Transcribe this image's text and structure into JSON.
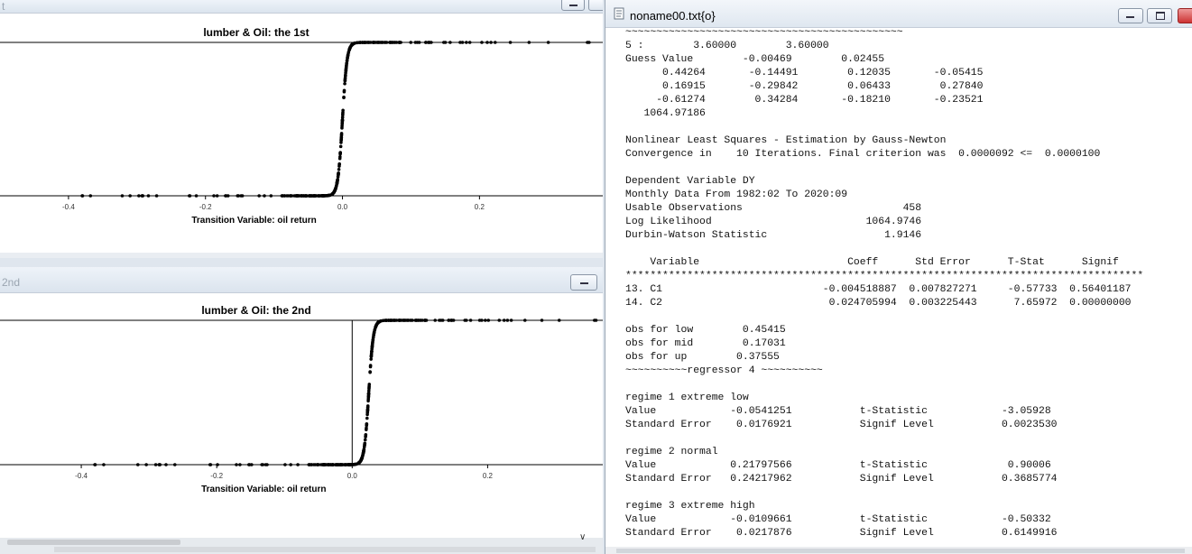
{
  "graph1": {
    "window_title": "t",
    "chart_data": {
      "type": "scatter",
      "title": "lumber & Oil: the 1st",
      "xlabel": "Transition Variable: oil return",
      "ylabel": "",
      "x_ticks": [
        "-0.4",
        "-0.2",
        "0.0",
        "0.2"
      ],
      "xlim": [
        -0.5,
        0.38
      ],
      "ylim": [
        0,
        1
      ],
      "transition_center": 0.0,
      "transition_slope": 300,
      "x_min_point": -0.38,
      "x_max_point": 0.36,
      "grid": false,
      "legend": "none"
    }
  },
  "graph2": {
    "window_title": "2nd",
    "chart_data": {
      "type": "scatter",
      "title": "lumber & Oil: the 2nd",
      "xlabel": "Transition Variable: oil return",
      "ylabel": "",
      "x_ticks": [
        "-0.4",
        "-0.2",
        "0.0",
        "0.2"
      ],
      "xlim": [
        -0.52,
        0.37
      ],
      "ylim": [
        0,
        1
      ],
      "transition_center": 0.0245,
      "transition_slope": 300,
      "x_min_point": -0.38,
      "x_max_point": 0.36,
      "grid": false,
      "legend": "none"
    }
  },
  "textwin": {
    "title": "noname00.txt{o}",
    "lines": [
      "~~~~~~~~~~~~~~~~~~~~~~~~~~~~~~~~~~~~~~~~~~~~~",
      "5 :        3.60000        3.60000",
      "Guess Value        -0.00469        0.02455",
      "      0.44264       -0.14491        0.12035       -0.05415",
      "      0.16915       -0.29842        0.06433        0.27840",
      "     -0.61274        0.34284       -0.18210       -0.23521",
      "   1064.97186",
      "",
      "Nonlinear Least Squares - Estimation by Gauss-Newton",
      "Convergence in    10 Iterations. Final criterion was  0.0000092 <=  0.0000100",
      "",
      "Dependent Variable DY",
      "Monthly Data From 1982:02 To 2020:09",
      "Usable Observations                          458",
      "Log Likelihood                         1064.9746",
      "Durbin-Watson Statistic                   1.9146",
      "",
      "    Variable                        Coeff      Std Error      T-Stat      Signif",
      "************************************************************************************",
      "13. C1                          -0.004518887  0.007827271     -0.57733  0.56401187",
      "14. C2                           0.024705994  0.003225443      7.65972  0.00000000",
      "",
      "obs for low        0.45415",
      "obs for mid        0.17031",
      "obs for up        0.37555",
      "~~~~~~~~~~regressor 4 ~~~~~~~~~~",
      "",
      "regime 1 extreme low",
      "Value            -0.0541251           t-Statistic            -3.05928",
      "Standard Error    0.0176921           Signif Level           0.0023530",
      "",
      "regime 2 normal",
      "Value            0.21797566           t-Statistic             0.90006",
      "Standard Error   0.24217962           Signif Level           0.3685774",
      "",
      "regime 3 extreme high",
      "Value            -0.0109661           t-Statistic            -0.50332",
      "Standard Error    0.0217876           Signif Level           0.6149916"
    ]
  }
}
